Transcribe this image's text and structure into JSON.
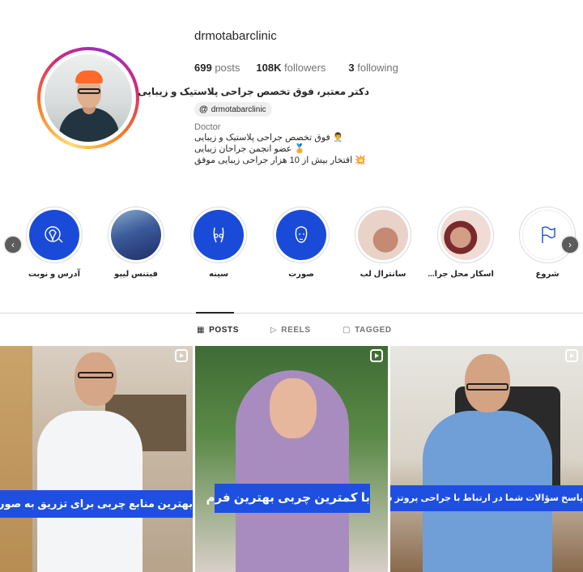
{
  "profile": {
    "username": "drmotabarclinic",
    "posts_count": "699",
    "posts_label": "posts",
    "followers_count": "108K",
    "followers_label": "followers",
    "following_count": "3",
    "following_label": "following",
    "full_name": "دکتر معتبر، فوق تخصص جراحی پلاستیک و زیبایی",
    "threads_handle": "drmotabarclinic",
    "category": "Doctor",
    "bio": [
      "👨‍⚕️ فوق تخصص جراحی پلاستیک و زیبایی",
      "🏅 عضو انجمن جراحان زیبایی",
      "💥 افتخار بیش از 10 هزار جراحی زیبایی موفق"
    ]
  },
  "highlights": [
    {
      "label": "آدرس و نوبت",
      "icon": "map-pin-icon"
    },
    {
      "label": "فیتنس لیپو",
      "icon": "photo"
    },
    {
      "label": "سینه",
      "icon": "body-outline-icon"
    },
    {
      "label": "صورت",
      "icon": "face-outline-icon"
    },
    {
      "label": "سانترال لب",
      "icon": "photo"
    },
    {
      "label": "اسکار محل جرا...",
      "icon": "photo"
    },
    {
      "label": "شروع",
      "icon": "flag-icon"
    }
  ],
  "tabs": [
    {
      "label": "POSTS",
      "icon": "grid-icon",
      "active": true
    },
    {
      "label": "REELS",
      "icon": "reels-icon",
      "active": false
    },
    {
      "label": "TAGGED",
      "icon": "tagged-icon",
      "active": false
    }
  ],
  "posts": [
    {
      "caption": "بهترین منابع چربی برای تزریق به صورت",
      "type": "reel"
    },
    {
      "caption": "با کمترین چربی بهترین فرم",
      "type": "reel"
    },
    {
      "caption": "پاسخ سؤالات شما در ارتباط با جراحی پروتز سینه",
      "type": "reel"
    }
  ],
  "colors": {
    "accent_blue": "#1f4fe0",
    "highlight_blue": "#1a4bd8",
    "text": "#262626",
    "muted": "#737373"
  }
}
